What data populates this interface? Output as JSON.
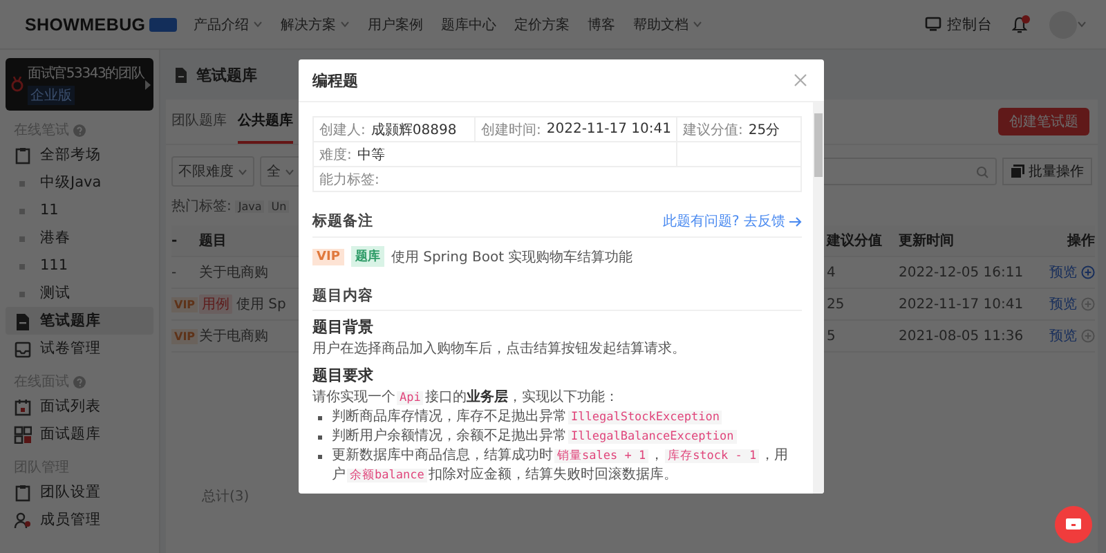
{
  "header": {
    "logo": "SHOWMEBUG",
    "nav": [
      {
        "label": "产品介绍",
        "dropdown": true
      },
      {
        "label": "解决方案",
        "dropdown": true
      },
      {
        "label": "用户案例",
        "dropdown": false
      },
      {
        "label": "题库中心",
        "dropdown": false
      },
      {
        "label": "定价方案",
        "dropdown": false
      },
      {
        "label": "博客",
        "dropdown": false
      },
      {
        "label": "帮助文档",
        "dropdown": true
      }
    ],
    "console": "控制台",
    "has_notification": true
  },
  "sidebar": {
    "team": {
      "name": "面试官53343的团队",
      "plan": "企业版"
    },
    "sections": [
      {
        "title": "在线笔试",
        "help": true,
        "items": [
          {
            "label": "全部考场",
            "kind": "clipboard",
            "selected": false
          },
          {
            "label": "中级Java",
            "kind": "bullet",
            "selected": false
          },
          {
            "label": "11",
            "kind": "bullet",
            "selected": false
          },
          {
            "label": "港春",
            "kind": "bullet",
            "selected": false
          },
          {
            "label": "111",
            "kind": "bullet",
            "selected": false
          },
          {
            "label": "测试",
            "kind": "bullet",
            "selected": false
          },
          {
            "label": "笔试题库",
            "kind": "document",
            "selected": true
          },
          {
            "label": "试卷管理",
            "kind": "tray",
            "selected": false
          }
        ]
      },
      {
        "title": "在线面试",
        "help": true,
        "items": [
          {
            "label": "面试列表",
            "kind": "calendar",
            "selected": false
          },
          {
            "label": "面试题库",
            "kind": "grid",
            "selected": false
          }
        ]
      },
      {
        "title": "团队管理",
        "help": false,
        "items": [
          {
            "label": "团队设置",
            "kind": "clipboard",
            "selected": false
          },
          {
            "label": "成员管理",
            "kind": "people",
            "selected": false
          }
        ]
      }
    ]
  },
  "main": {
    "title": "笔试题库",
    "tabs": [
      {
        "label": "团队题库",
        "selected": false
      },
      {
        "label": "公共题库",
        "selected": true
      }
    ],
    "create_button": "创建笔试题",
    "filters": [
      {
        "value": "不限难度"
      },
      {
        "value": "全"
      }
    ],
    "batch_button": "批量操作",
    "hot_tags": {
      "label": "热门标签:",
      "tags": [
        "Java",
        "Un"
      ]
    },
    "table": {
      "columns": [
        "-",
        "题目",
        "建议分值",
        "更新时间",
        "操作"
      ],
      "rows": [
        {
          "marker": {
            "kind": "dash",
            "text": "-"
          },
          "tags": [],
          "title": "关于电商购",
          "score": "4",
          "updated": "2022-12-05 16:11",
          "action": "预览",
          "highlighted": true
        },
        {
          "marker": {
            "kind": "vip",
            "text": "VIP"
          },
          "tags": [
            {
              "kind": "case",
              "label": "用例"
            }
          ],
          "title": "使用 Sp",
          "score": "25",
          "updated": "2022-11-17 10:41",
          "action": "预览",
          "highlighted": false
        },
        {
          "marker": {
            "kind": "vip",
            "text": "VIP"
          },
          "tags": [],
          "title": "关于电商购",
          "score": "5",
          "updated": "2021-08-05 11:36",
          "action": "预览",
          "highlighted": false
        }
      ]
    },
    "total": "总计(3)"
  },
  "modal": {
    "title": "编程题",
    "info_rows": [
      [
        {
          "label": "创建人:",
          "value": "成颢辉08898"
        },
        {
          "label": "创建时间:",
          "value": "2022-11-17 10:41"
        },
        {
          "label": "建议分值:",
          "value": "25分"
        }
      ],
      [
        {
          "label": "难度:",
          "value": "中等"
        }
      ],
      [
        {
          "label": "能力标签:"
        }
      ]
    ],
    "remark_title": "标题备注",
    "feedback_link": "此题有问题? 去反馈",
    "tags": [
      {
        "kind": "vip",
        "label": "VIP"
      },
      {
        "kind": "bank",
        "label": "题库"
      }
    ],
    "remark_text": "使用 Spring Boot 实现购物车结算功能",
    "content_title": "题目内容",
    "blocks": [
      {
        "kind": "heading",
        "text": "题目背景"
      },
      {
        "kind": "paragraph",
        "segments": [
          {
            "kind": "text",
            "text": "用户在选择商品加入购物车后，点击结算按钮发起结算请求。"
          }
        ]
      },
      {
        "kind": "heading",
        "text": "题目要求"
      },
      {
        "kind": "paragraph",
        "segments": [
          {
            "kind": "text",
            "text": "请你实现一个"
          },
          {
            "kind": "code",
            "text": "Api"
          },
          {
            "kind": "text",
            "text": "接口的"
          },
          {
            "kind": "strong",
            "text": "业务层"
          },
          {
            "kind": "text",
            "text": "，实现以下功能："
          }
        ]
      },
      {
        "kind": "list",
        "items": [
          [
            {
              "kind": "text",
              "text": "判断商品库存情况，库存不足抛出异常"
            },
            {
              "kind": "code",
              "text": "IllegalStockException"
            }
          ],
          [
            {
              "kind": "text",
              "text": "判断用户余额情况，余额不足抛出异常"
            },
            {
              "kind": "code",
              "text": "IllegalBalanceException"
            }
          ],
          [
            {
              "kind": "text",
              "text": "更新数据库中商品信息，结算成功时"
            },
            {
              "kind": "code",
              "text": "销量sales + 1"
            },
            {
              "kind": "text",
              "text": "，"
            },
            {
              "kind": "code",
              "text": "库存stock - 1"
            },
            {
              "kind": "text",
              "text": "，用户"
            },
            {
              "kind": "code",
              "text": "余额balance"
            },
            {
              "kind": "text",
              "text": "扣除对应金额，结算失败时回滚数据库。"
            }
          ]
        ]
      }
    ]
  }
}
